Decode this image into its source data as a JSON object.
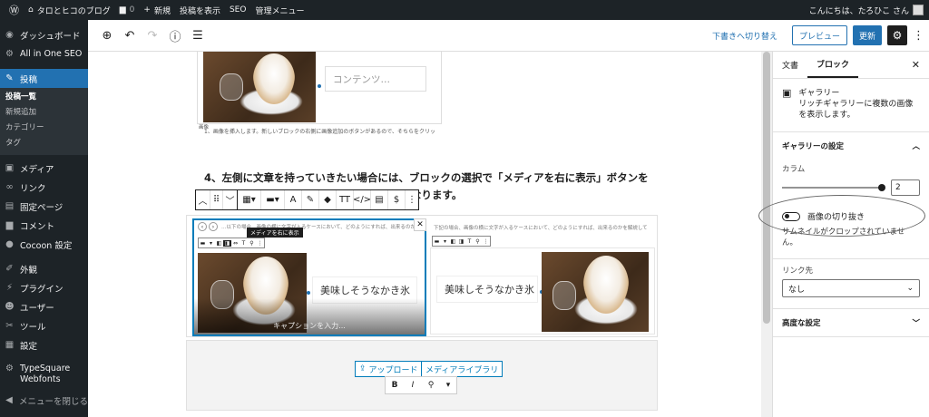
{
  "adminbar": {
    "wp_logo": "wordpress-icon",
    "site_name": "タロとヒコのブログ",
    "comments_count": "0",
    "new_label": "新規",
    "view_post": "投稿を表示",
    "seo": "SEO",
    "admin_menu": "管理メニュー",
    "greeting": "こんにちは、たろひこ さん"
  },
  "menu": {
    "items": [
      {
        "label": "ダッシュボード",
        "icon": "dashboard-icon"
      },
      {
        "label": "All in One SEO",
        "icon": "seo-icon"
      },
      {
        "label": "投稿",
        "icon": "pin-icon"
      },
      {
        "label": "メディア",
        "icon": "media-icon"
      },
      {
        "label": "リンク",
        "icon": "link-icon"
      },
      {
        "label": "固定ページ",
        "icon": "page-icon"
      },
      {
        "label": "コメント",
        "icon": "comment-icon"
      },
      {
        "label": "Cocoon 設定",
        "icon": "cocoon-icon"
      },
      {
        "label": "外観",
        "icon": "appearance-icon"
      },
      {
        "label": "プラグイン",
        "icon": "plugin-icon"
      },
      {
        "label": "ユーザー",
        "icon": "user-icon"
      },
      {
        "label": "ツール",
        "icon": "tool-icon"
      },
      {
        "label": "設定",
        "icon": "settings-icon"
      },
      {
        "label": "TypeSquare Webfonts",
        "icon": "typesquare-icon"
      },
      {
        "label": "メニューを閉じる",
        "icon": "collapse-icon"
      }
    ],
    "submenu": [
      "投稿一覧",
      "新規追加",
      "カテゴリー",
      "タグ"
    ]
  },
  "toolbar": {
    "switch_draft": "下書きへ切り替え",
    "preview": "プレビュー",
    "update": "更新"
  },
  "content": {
    "top_text_placeholder": "コンテンツ…",
    "top_caption_label": "画像",
    "top_caption": "1、画像を挿入します。新しいブロックの右側に画像追加のボタンがあるので、そちらをクリッ",
    "heading": "4、左側に文章を持っていきたい場合には、ブロックの選択で「メディアを右に表示」ボタンを押すと、左側に画像を持ってくる事が可能となります。",
    "tooltip": "メディアを右に表示",
    "left_desc": "…以下の場合、画像の横に文字が入るケースにおいて、どのようにすれば、出来るのかを解説して",
    "right_desc": "下記の場合、画像の横に文字が入るケースにおいて、どのようにすれば、出来るのかを解説して",
    "left_text": "美味しそうなかき氷",
    "right_text": "美味しそうなかき氷",
    "caption_placeholder": "キャプションを入力...",
    "upload": "アップロード",
    "media_library": "メディアライブラリ"
  },
  "sidebar": {
    "tab_document": "文書",
    "tab_block": "ブロック",
    "block_name": "ギャラリー",
    "block_desc": "リッチギャラリーに複数の画像を表示します。",
    "gallery_settings": "ギャラリーの設定",
    "columns_label": "カラム",
    "columns_value": "2",
    "crop_label": "画像の切り抜き",
    "crop_help": "サムネイルがクロップされていません。",
    "link_label": "リンク先",
    "link_value": "なし",
    "advanced": "高度な設定"
  }
}
